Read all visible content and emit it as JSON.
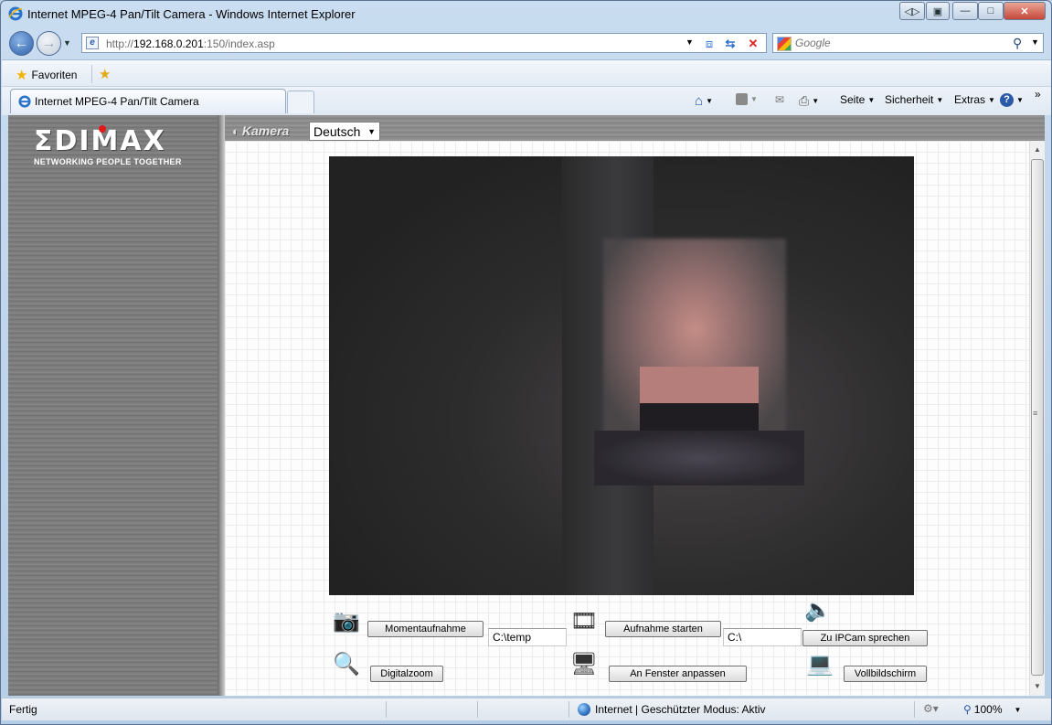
{
  "window": {
    "title": "Internet MPEG-4 Pan/Tilt Camera - Windows Internet Explorer",
    "buttons": {
      "minimize": "—",
      "maximize": "□",
      "close": "✕"
    }
  },
  "address": {
    "url_prefix": "http://",
    "url_host": "192.168.0.201",
    "url_rest": ":150/index.asp"
  },
  "search": {
    "placeholder": "Google"
  },
  "favorites": {
    "label": "Favoriten"
  },
  "tab": {
    "title": "Internet MPEG-4 Pan/Tilt Camera"
  },
  "commands": {
    "page": "Seite",
    "security": "Sicherheit",
    "extras": "Extras",
    "chevrons": "»"
  },
  "page": {
    "logo_word": "ΣDIMAX",
    "logo_tagline": "NETWORKING PEOPLE TOGETHER",
    "section_label": "Kamera",
    "language": "Deutsch"
  },
  "controls": {
    "snapshot": "Momentaufnahme",
    "snapshot_path": "C:\\temp",
    "record": "Aufnahme starten",
    "record_path": "C:\\",
    "talk": "Zu IPCam sprechen",
    "digital_zoom": "Digitalzoom",
    "fit_window": "An Fenster anpassen",
    "fullscreen": "Vollbildschirm"
  },
  "status": {
    "ready": "Fertig",
    "zone": "Internet | Geschützter Modus: Aktiv",
    "zoom": "100%"
  },
  "colors": {
    "accent_red": "#e01a1a",
    "panel_gray": "#808080"
  }
}
